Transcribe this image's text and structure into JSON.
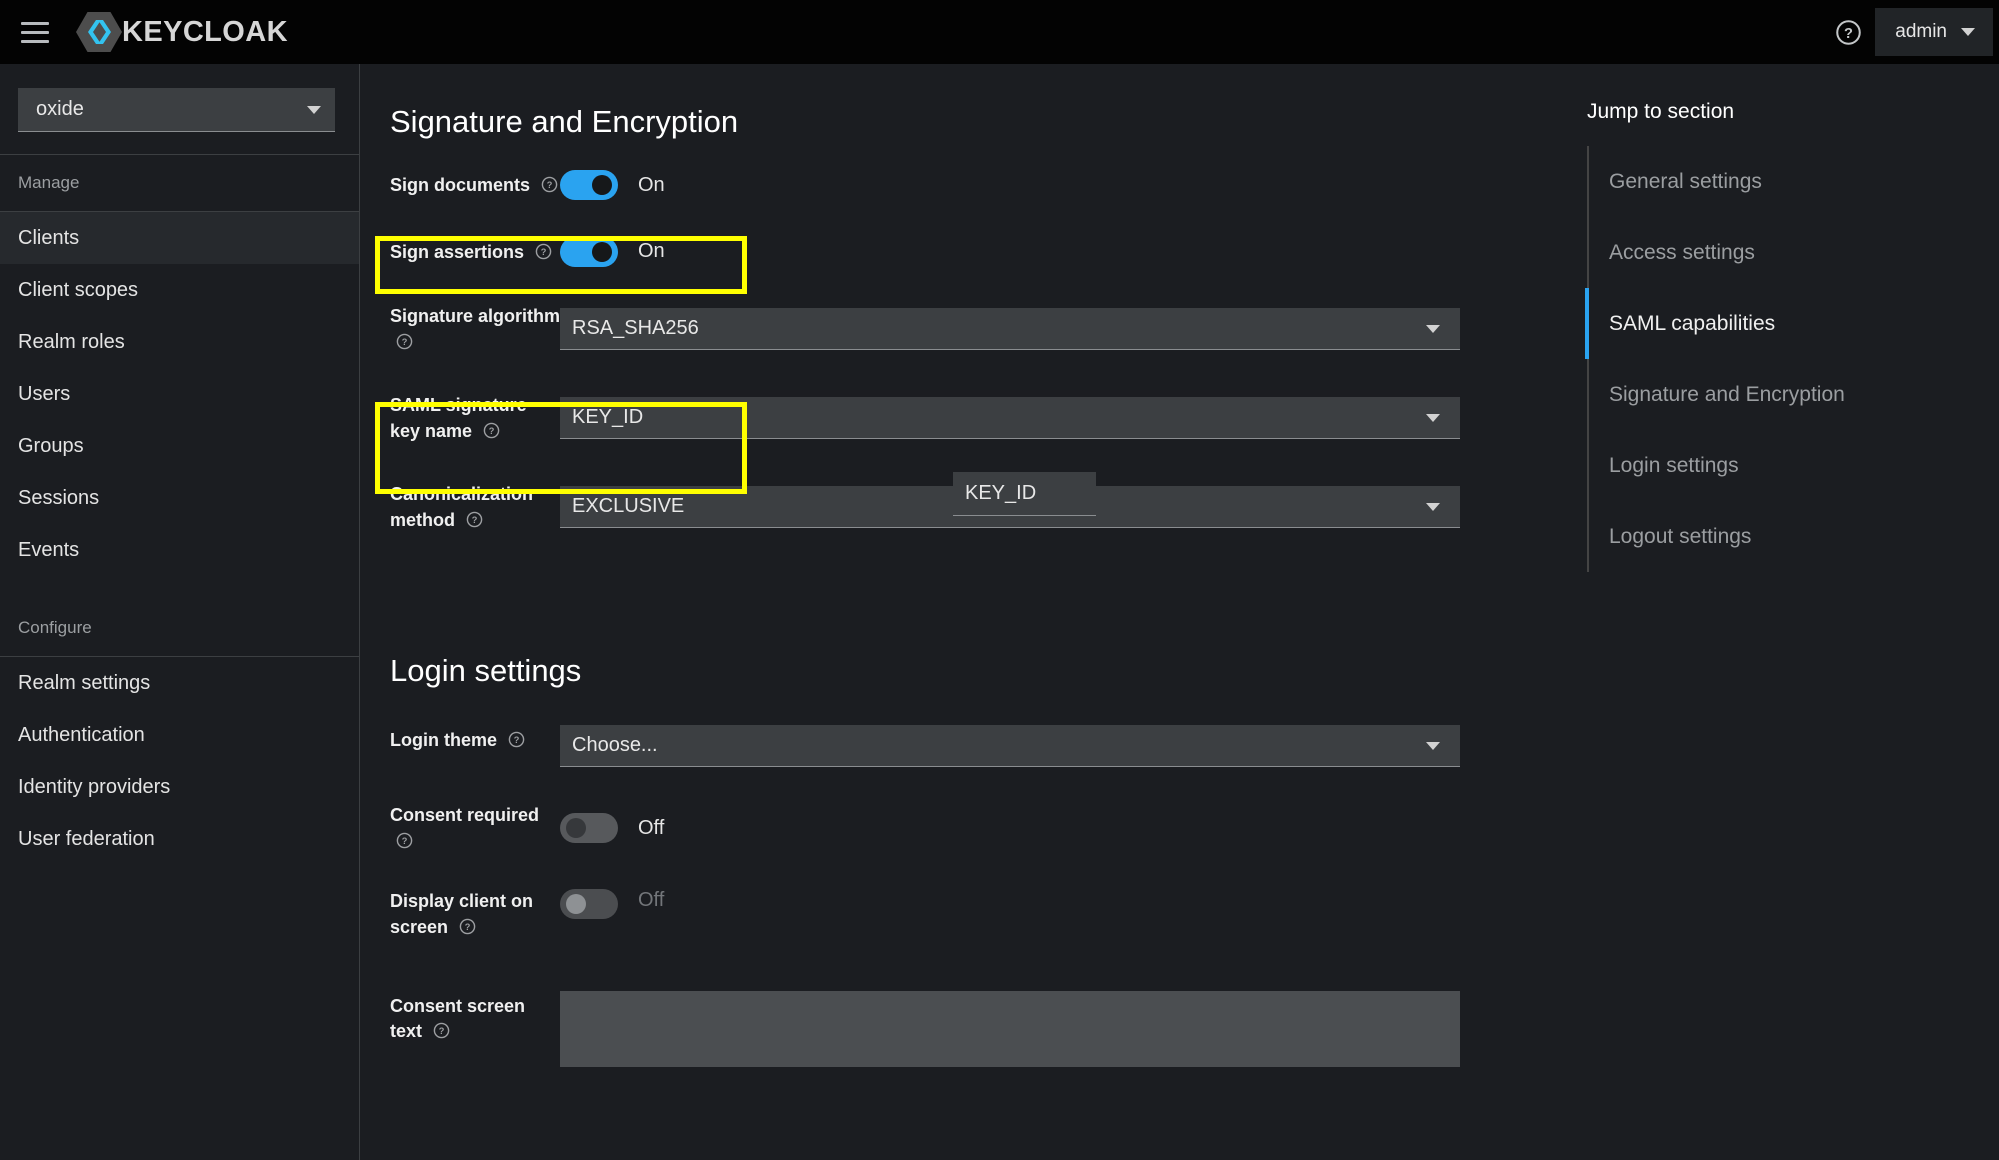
{
  "masthead": {
    "menu_icon": "hamburger-icon",
    "brand_text": "KEYCLOAK",
    "help_icon": "question-circle-icon",
    "user_name": "admin",
    "user_caret_icon": "caret-down-icon"
  },
  "sidebar": {
    "realm": {
      "value": "oxide",
      "caret_icon": "caret-down-icon"
    },
    "groups": [
      {
        "title": "Manage",
        "items": [
          {
            "label": "Clients",
            "active": true
          },
          {
            "label": "Client scopes",
            "active": false
          },
          {
            "label": "Realm roles",
            "active": false
          },
          {
            "label": "Users",
            "active": false
          },
          {
            "label": "Groups",
            "active": false
          },
          {
            "label": "Sessions",
            "active": false
          },
          {
            "label": "Events",
            "active": false
          }
        ]
      },
      {
        "title": "Configure",
        "items": [
          {
            "label": "Realm settings",
            "active": false
          },
          {
            "label": "Authentication",
            "active": false
          },
          {
            "label": "Identity providers",
            "active": false
          },
          {
            "label": "User federation",
            "active": false
          }
        ]
      }
    ]
  },
  "signature_section": {
    "title": "Signature and Encryption",
    "sign_documents": {
      "label": "Sign documents",
      "help_icon": "question-circle-icon",
      "state": "On"
    },
    "sign_assertions": {
      "label": "Sign assertions",
      "help_icon": "question-circle-icon",
      "state": "On",
      "highlighted": true
    },
    "signature_algorithm": {
      "label": "Signature algorithm",
      "help_icon": "question-circle-icon",
      "value": "RSA_SHA256",
      "caret_icon": "caret-down-icon"
    },
    "saml_signature_key_name": {
      "label": "SAML signature key name",
      "help_icon": "question-circle-icon",
      "value": "KEY_ID",
      "caret_icon": "caret-down-icon",
      "highlighted": true
    },
    "canonicalization_method": {
      "label": "Canonicalization method",
      "help_icon": "question-circle-icon",
      "value": "EXCLUSIVE",
      "caret_icon": "caret-down-icon"
    }
  },
  "login_section": {
    "title": "Login settings",
    "login_theme": {
      "label": "Login theme",
      "help_icon": "question-circle-icon",
      "value": "Choose...",
      "caret_icon": "caret-down-icon"
    },
    "consent_required": {
      "label": "Consent required",
      "help_icon": "question-circle-icon",
      "state": "Off"
    },
    "display_client_on_screen": {
      "label": "Display client on screen",
      "help_icon": "question-circle-icon",
      "state": "Off",
      "disabled": true
    },
    "consent_screen_text": {
      "label": "Consent screen text",
      "help_icon": "question-circle-icon",
      "value": "",
      "placeholder": ""
    }
  },
  "jump": {
    "title": "Jump to section",
    "items": [
      {
        "label": "General settings",
        "active": false
      },
      {
        "label": "Access settings",
        "active": false
      },
      {
        "label": "SAML capabilities",
        "active": true
      },
      {
        "label": "Signature and Encryption",
        "active": false
      },
      {
        "label": "Login settings",
        "active": false
      },
      {
        "label": "Logout settings",
        "active": false
      }
    ]
  },
  "colors": {
    "accent": "#2aa3f0",
    "highlight": "#ffff00",
    "background": "#1b1d21",
    "masthead": "#030303"
  }
}
